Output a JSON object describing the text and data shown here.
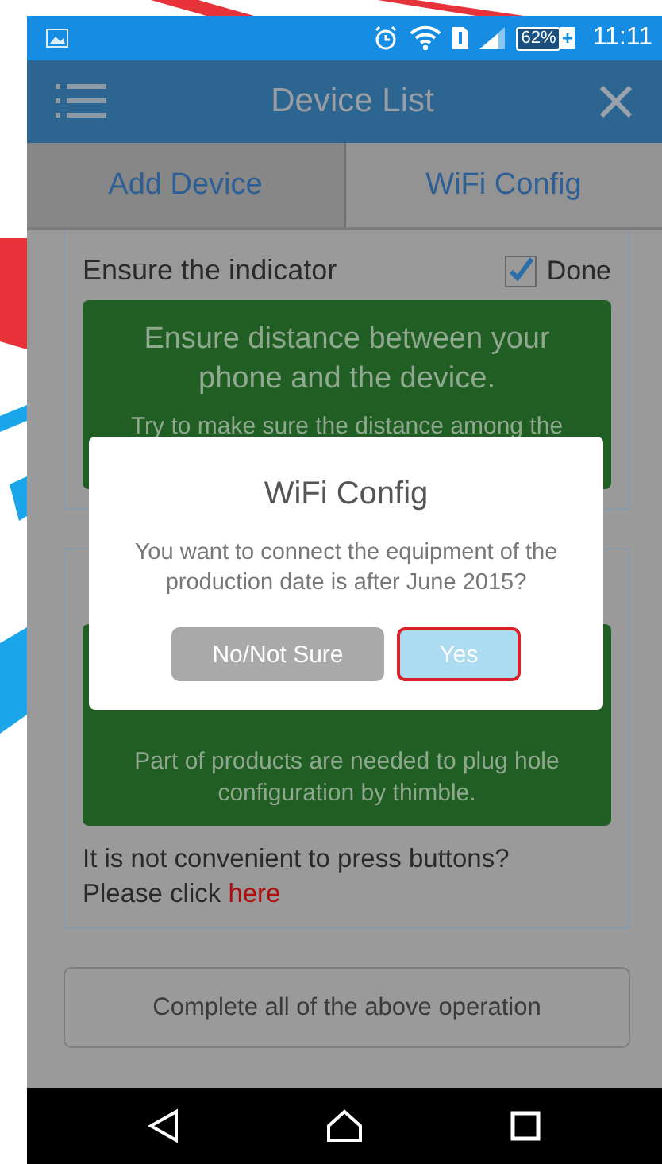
{
  "status_bar": {
    "battery": "62%",
    "time": "11:11"
  },
  "app_bar": {
    "title": "Device List"
  },
  "tabs": [
    {
      "label": "Add Device",
      "selected": false
    },
    {
      "label": "WiFi Config",
      "selected": true
    }
  ],
  "steps": [
    {
      "title": "Ensure the indicator",
      "done_label": "Done",
      "checked": true,
      "heading": "Ensure distance between your phone and the device.",
      "note": "Try to make sure the distance among the"
    },
    {
      "note": "Part of products are needed to plug hole configuration by thimble."
    }
  ],
  "help": {
    "text": "It is not convenient to press buttons?\nPlease click",
    "link": "here"
  },
  "complete_button": "Complete all of the above operation",
  "dialog": {
    "title": "WiFi Config",
    "message": "You want to connect the equipment of the production date is after June 2015?",
    "buttons": [
      {
        "label": "No/Not Sure",
        "kind": "secondary",
        "selected": false
      },
      {
        "label": "Yes",
        "kind": "primary",
        "selected": true
      }
    ]
  }
}
